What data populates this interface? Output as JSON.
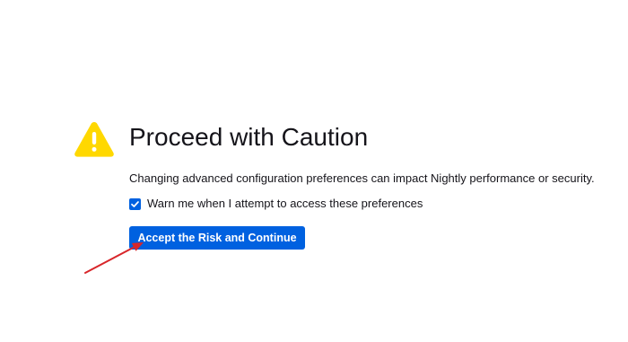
{
  "page": {
    "icon": "warning-triangle-icon",
    "title": "Proceed with Caution",
    "description": "Changing advanced configuration preferences can impact Nightly performance or security.",
    "checkbox": {
      "label": "Warn me when I attempt to access these preferences",
      "checked": true
    },
    "button": {
      "label": "Accept the Risk and Continue"
    }
  },
  "annotation": {
    "type": "arrow",
    "color": "#d8262a",
    "points_to": "accept-button"
  },
  "colors": {
    "accent": "#0061e0",
    "warning": "#ffd800",
    "text": "#15141a",
    "background": "#ffffff"
  }
}
